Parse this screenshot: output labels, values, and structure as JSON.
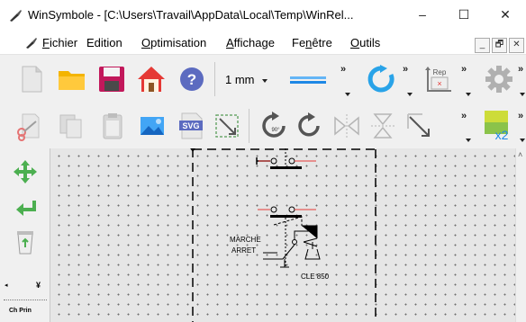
{
  "window": {
    "title": "WinSymbole - [C:\\Users\\Travail\\AppData\\Local\\Temp\\WinRel...",
    "minimize": "–",
    "maximize": "☐",
    "close": "✕"
  },
  "menu": {
    "items": [
      {
        "accel": "F",
        "rest": "ichier"
      },
      {
        "accel": "",
        "rest": "Edition"
      },
      {
        "accel": "O",
        "rest": "ptimisation"
      },
      {
        "accel": "A",
        "rest": "ffichage"
      },
      {
        "pre": "Fe",
        "accel": "n",
        "rest": "être"
      },
      {
        "accel": "O",
        "rest": "utils"
      }
    ],
    "mdi": [
      "_",
      "🗗",
      "✕"
    ]
  },
  "toolbar": {
    "line_width": "1 mm",
    "rep_label": "Rep",
    "more": "»"
  },
  "palette": {
    "label": "Ch Prin"
  },
  "canvas": {
    "label_marche": "MARCHE",
    "label_arret": "ARRET",
    "label_cle": "CLE 850"
  },
  "colors": {
    "accent_blue": "#1e88e5",
    "green_arrow": "#4caf50",
    "wire_red": "#e53935",
    "rotate_blue": "#29a3e8"
  }
}
